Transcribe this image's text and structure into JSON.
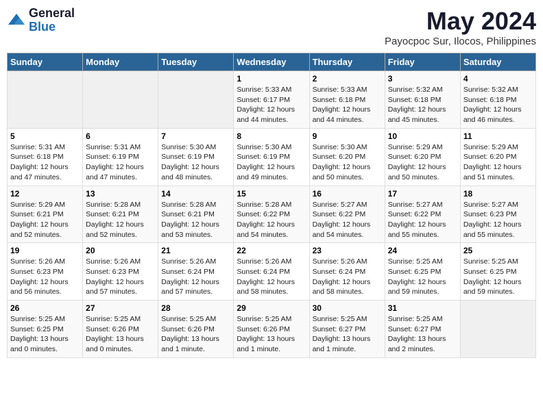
{
  "logo": {
    "general": "General",
    "blue": "Blue"
  },
  "title": "May 2024",
  "subtitle": "Payocpoc Sur, Ilocos, Philippines",
  "days_of_week": [
    "Sunday",
    "Monday",
    "Tuesday",
    "Wednesday",
    "Thursday",
    "Friday",
    "Saturday"
  ],
  "weeks": [
    [
      {
        "num": "",
        "info": ""
      },
      {
        "num": "",
        "info": ""
      },
      {
        "num": "",
        "info": ""
      },
      {
        "num": "1",
        "info": "Sunrise: 5:33 AM\nSunset: 6:17 PM\nDaylight: 12 hours\nand 44 minutes."
      },
      {
        "num": "2",
        "info": "Sunrise: 5:33 AM\nSunset: 6:18 PM\nDaylight: 12 hours\nand 44 minutes."
      },
      {
        "num": "3",
        "info": "Sunrise: 5:32 AM\nSunset: 6:18 PM\nDaylight: 12 hours\nand 45 minutes."
      },
      {
        "num": "4",
        "info": "Sunrise: 5:32 AM\nSunset: 6:18 PM\nDaylight: 12 hours\nand 46 minutes."
      }
    ],
    [
      {
        "num": "5",
        "info": "Sunrise: 5:31 AM\nSunset: 6:18 PM\nDaylight: 12 hours\nand 47 minutes."
      },
      {
        "num": "6",
        "info": "Sunrise: 5:31 AM\nSunset: 6:19 PM\nDaylight: 12 hours\nand 47 minutes."
      },
      {
        "num": "7",
        "info": "Sunrise: 5:30 AM\nSunset: 6:19 PM\nDaylight: 12 hours\nand 48 minutes."
      },
      {
        "num": "8",
        "info": "Sunrise: 5:30 AM\nSunset: 6:19 PM\nDaylight: 12 hours\nand 49 minutes."
      },
      {
        "num": "9",
        "info": "Sunrise: 5:30 AM\nSunset: 6:20 PM\nDaylight: 12 hours\nand 50 minutes."
      },
      {
        "num": "10",
        "info": "Sunrise: 5:29 AM\nSunset: 6:20 PM\nDaylight: 12 hours\nand 50 minutes."
      },
      {
        "num": "11",
        "info": "Sunrise: 5:29 AM\nSunset: 6:20 PM\nDaylight: 12 hours\nand 51 minutes."
      }
    ],
    [
      {
        "num": "12",
        "info": "Sunrise: 5:29 AM\nSunset: 6:21 PM\nDaylight: 12 hours\nand 52 minutes."
      },
      {
        "num": "13",
        "info": "Sunrise: 5:28 AM\nSunset: 6:21 PM\nDaylight: 12 hours\nand 52 minutes."
      },
      {
        "num": "14",
        "info": "Sunrise: 5:28 AM\nSunset: 6:21 PM\nDaylight: 12 hours\nand 53 minutes."
      },
      {
        "num": "15",
        "info": "Sunrise: 5:28 AM\nSunset: 6:22 PM\nDaylight: 12 hours\nand 54 minutes."
      },
      {
        "num": "16",
        "info": "Sunrise: 5:27 AM\nSunset: 6:22 PM\nDaylight: 12 hours\nand 54 minutes."
      },
      {
        "num": "17",
        "info": "Sunrise: 5:27 AM\nSunset: 6:22 PM\nDaylight: 12 hours\nand 55 minutes."
      },
      {
        "num": "18",
        "info": "Sunrise: 5:27 AM\nSunset: 6:23 PM\nDaylight: 12 hours\nand 55 minutes."
      }
    ],
    [
      {
        "num": "19",
        "info": "Sunrise: 5:26 AM\nSunset: 6:23 PM\nDaylight: 12 hours\nand 56 minutes."
      },
      {
        "num": "20",
        "info": "Sunrise: 5:26 AM\nSunset: 6:23 PM\nDaylight: 12 hours\nand 57 minutes."
      },
      {
        "num": "21",
        "info": "Sunrise: 5:26 AM\nSunset: 6:24 PM\nDaylight: 12 hours\nand 57 minutes."
      },
      {
        "num": "22",
        "info": "Sunrise: 5:26 AM\nSunset: 6:24 PM\nDaylight: 12 hours\nand 58 minutes."
      },
      {
        "num": "23",
        "info": "Sunrise: 5:26 AM\nSunset: 6:24 PM\nDaylight: 12 hours\nand 58 minutes."
      },
      {
        "num": "24",
        "info": "Sunrise: 5:25 AM\nSunset: 6:25 PM\nDaylight: 12 hours\nand 59 minutes."
      },
      {
        "num": "25",
        "info": "Sunrise: 5:25 AM\nSunset: 6:25 PM\nDaylight: 12 hours\nand 59 minutes."
      }
    ],
    [
      {
        "num": "26",
        "info": "Sunrise: 5:25 AM\nSunset: 6:25 PM\nDaylight: 13 hours\nand 0 minutes."
      },
      {
        "num": "27",
        "info": "Sunrise: 5:25 AM\nSunset: 6:26 PM\nDaylight: 13 hours\nand 0 minutes."
      },
      {
        "num": "28",
        "info": "Sunrise: 5:25 AM\nSunset: 6:26 PM\nDaylight: 13 hours\nand 1 minute."
      },
      {
        "num": "29",
        "info": "Sunrise: 5:25 AM\nSunset: 6:26 PM\nDaylight: 13 hours\nand 1 minute."
      },
      {
        "num": "30",
        "info": "Sunrise: 5:25 AM\nSunset: 6:27 PM\nDaylight: 13 hours\nand 1 minute."
      },
      {
        "num": "31",
        "info": "Sunrise: 5:25 AM\nSunset: 6:27 PM\nDaylight: 13 hours\nand 2 minutes."
      },
      {
        "num": "",
        "info": ""
      }
    ]
  ]
}
